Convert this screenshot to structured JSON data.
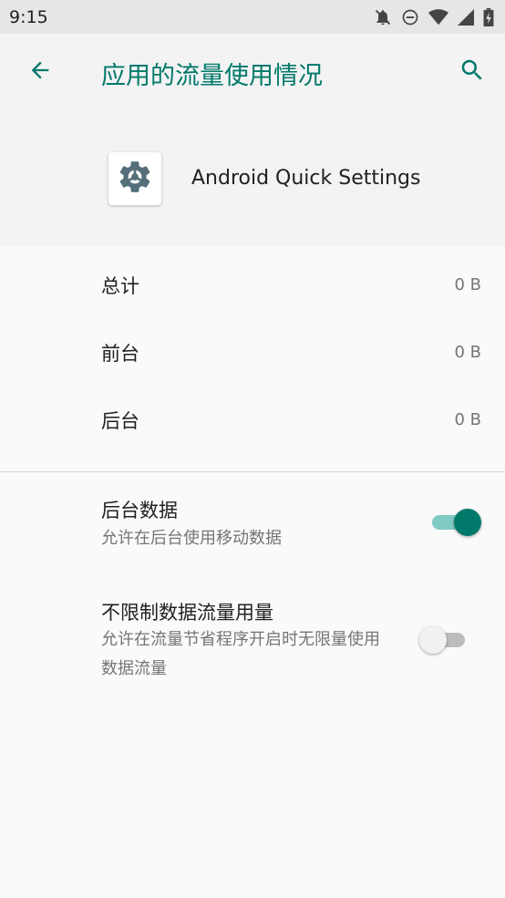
{
  "status_bar": {
    "time": "9:15",
    "icons": [
      "notifications-off-icon",
      "do-not-disturb-icon",
      "wifi-icon",
      "signal-icon",
      "battery-charging-icon"
    ]
  },
  "toolbar": {
    "title": "应用的流量使用情况",
    "back_icon": "arrow-back-icon",
    "search_icon": "search-icon"
  },
  "app": {
    "name": "Android Quick Settings",
    "icon": "gear-icon"
  },
  "usage": [
    {
      "label": "总计",
      "value": "0 B"
    },
    {
      "label": "前台",
      "value": "0 B"
    },
    {
      "label": "后台",
      "value": "0 B"
    }
  ],
  "preferences": {
    "background_data": {
      "title": "后台数据",
      "summary": "允许在后台使用移动数据",
      "enabled": true
    },
    "unrestricted_data": {
      "title": "不限制数据流量用量",
      "summary": "允许在流量节省程序开启时无限量使用数据流量",
      "enabled": false
    }
  },
  "colors": {
    "accent": "#00796b",
    "accent_light": "#80cbc4",
    "status_bar": "#e6e6e6",
    "header_bg": "#f3f3f3"
  }
}
